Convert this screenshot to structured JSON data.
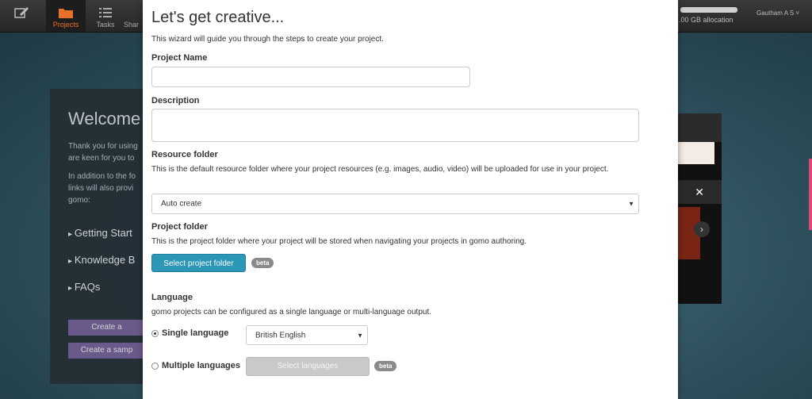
{
  "topbar": {
    "nav": [
      {
        "label": "",
        "icon": "edit-icon"
      },
      {
        "label": "Projects",
        "icon": "folder-icon"
      },
      {
        "label": "Tasks",
        "icon": "list-icon"
      },
      {
        "label": "Shar",
        "icon": "share-icon"
      }
    ],
    "storage_text": ".00 GB allocation",
    "user_label": "Gautham A S",
    "user_icon": "chevron-down-icon",
    "accent_color": "#e8702a"
  },
  "background": {
    "welcome_title": "Welcome",
    "welcome_p1": "Thank you for using are keen for you to",
    "welcome_p2": "In addition to the fo links will also provi gomo:",
    "links": [
      "Getting Start",
      "Knowledge B",
      "FAQs"
    ],
    "buttons": [
      "Create a ",
      "Create a samp"
    ],
    "video_labels": {
      "close": "✕",
      "next": "›"
    }
  },
  "modal": {
    "title": "Let's get creative...",
    "intro": "This wizard will guide you through the steps to create your project.",
    "project_name": {
      "label": "Project Name",
      "value": "",
      "placeholder": ""
    },
    "description": {
      "label": "Description",
      "value": "",
      "placeholder": ""
    },
    "resource_folder": {
      "label": "Resource folder",
      "help": "This is the default resource folder where your project resources (e.g. images, audio, video) will be uploaded for use in your project.",
      "selected": "Auto create"
    },
    "project_folder": {
      "label": "Project folder",
      "help": "This is the project folder where your project will be stored when navigating your projects in gomo authoring.",
      "button": "Select project folder",
      "badge": "beta"
    },
    "language": {
      "label": "Language",
      "help": "gomo projects can be configured as a single language or multi-language output.",
      "single_label": "Single language",
      "single_selected": true,
      "single_value": "British English",
      "multiple_label": "Multiple languages",
      "multiple_selected": false,
      "multiple_button": "Select languages",
      "badge": "beta"
    },
    "button_color": "#2b96b5"
  }
}
